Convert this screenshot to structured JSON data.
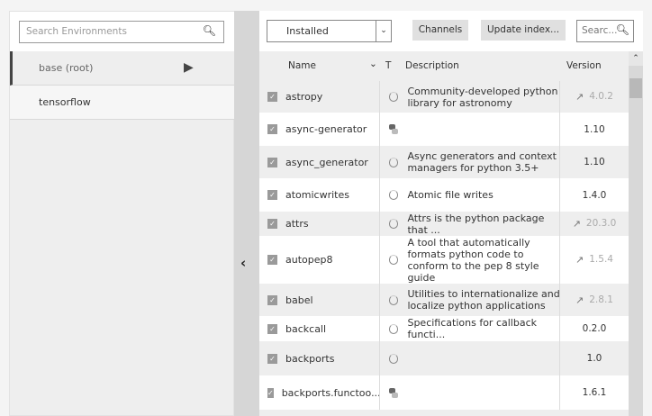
{
  "environments": {
    "search_placeholder": "Search Environments",
    "items": [
      {
        "label": "base (root)",
        "active": true
      },
      {
        "label": "tensorflow",
        "active": false
      }
    ]
  },
  "toolbar": {
    "filter_value": "Installed",
    "channels_label": "Channels",
    "update_label": "Update index...",
    "search_placeholder": "Searc..."
  },
  "table": {
    "headers": {
      "name": "Name",
      "type": "T",
      "description": "Description",
      "version": "Version"
    },
    "rows": [
      {
        "name": "astropy",
        "checked": true,
        "type_icon": "conda-circle-icon",
        "description": "Community-developed python library for astronomy",
        "version": "4.0.2",
        "update_available": true
      },
      {
        "name": "async-generator",
        "checked": true,
        "type_icon": "python-icon",
        "description": "",
        "version": "1.10",
        "update_available": false
      },
      {
        "name": "async_generator",
        "checked": true,
        "type_icon": "conda-circle-icon",
        "description": "Async generators and context managers for python 3.5+",
        "version": "1.10",
        "update_available": false
      },
      {
        "name": "atomicwrites",
        "checked": true,
        "type_icon": "conda-circle-icon",
        "description": "Atomic file writes",
        "version": "1.4.0",
        "update_available": false
      },
      {
        "name": "attrs",
        "checked": true,
        "type_icon": "conda-circle-icon",
        "description": "Attrs is the python package that ...",
        "version": "20.3.0",
        "update_available": true
      },
      {
        "name": "autopep8",
        "checked": true,
        "type_icon": "conda-circle-icon",
        "description": "A tool that automatically formats python code to conform to the pep 8 style guide",
        "version": "1.5.4",
        "update_available": true
      },
      {
        "name": "babel",
        "checked": true,
        "type_icon": "conda-circle-icon",
        "description": "Utilities to internationalize and localize python applications",
        "version": "2.8.1",
        "update_available": true
      },
      {
        "name": "backcall",
        "checked": true,
        "type_icon": "conda-circle-icon",
        "description": "Specifications for callback functi...",
        "version": "0.2.0",
        "update_available": false
      },
      {
        "name": "backports",
        "checked": true,
        "type_icon": "conda-circle-icon",
        "description": "",
        "version": "1.0",
        "update_available": false
      },
      {
        "name": "backports.functoo...",
        "checked": true,
        "type_icon": "python-icon",
        "description": "",
        "version": "1.6.1",
        "update_available": false
      }
    ]
  }
}
